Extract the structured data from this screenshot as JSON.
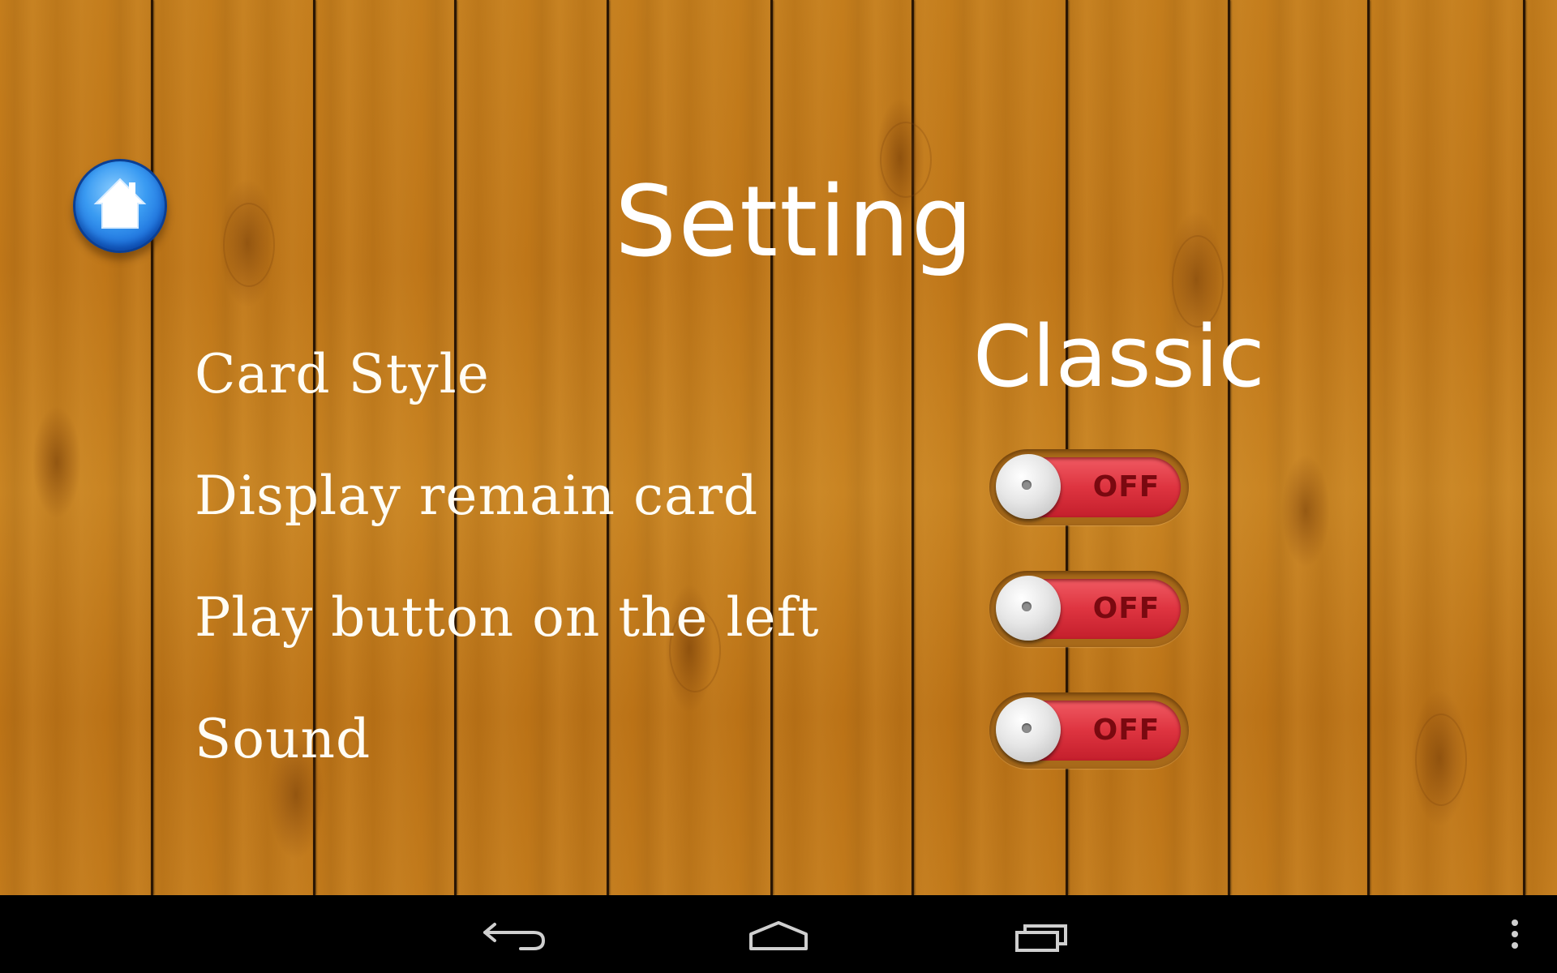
{
  "screen": {
    "title": "Setting"
  },
  "header": {
    "home_button_icon": "home-icon"
  },
  "settings": {
    "card_style": {
      "label": "Card Style",
      "value": "Classic"
    },
    "display_remain_card": {
      "label": "Display remain card",
      "state": "OFF"
    },
    "play_button_left": {
      "label": "Play button on the left",
      "state": "OFF"
    },
    "sound": {
      "label": "Sound",
      "state": "OFF"
    }
  },
  "navbar": {
    "back_icon": "back-arrow-icon",
    "home_icon": "home-outline-icon",
    "recents_icon": "recent-apps-icon",
    "menu_icon": "overflow-menu-icon"
  },
  "colors": {
    "toggle_off": "#de3440",
    "home_button": "#1e7fe6",
    "wood": "#c47d1c"
  }
}
